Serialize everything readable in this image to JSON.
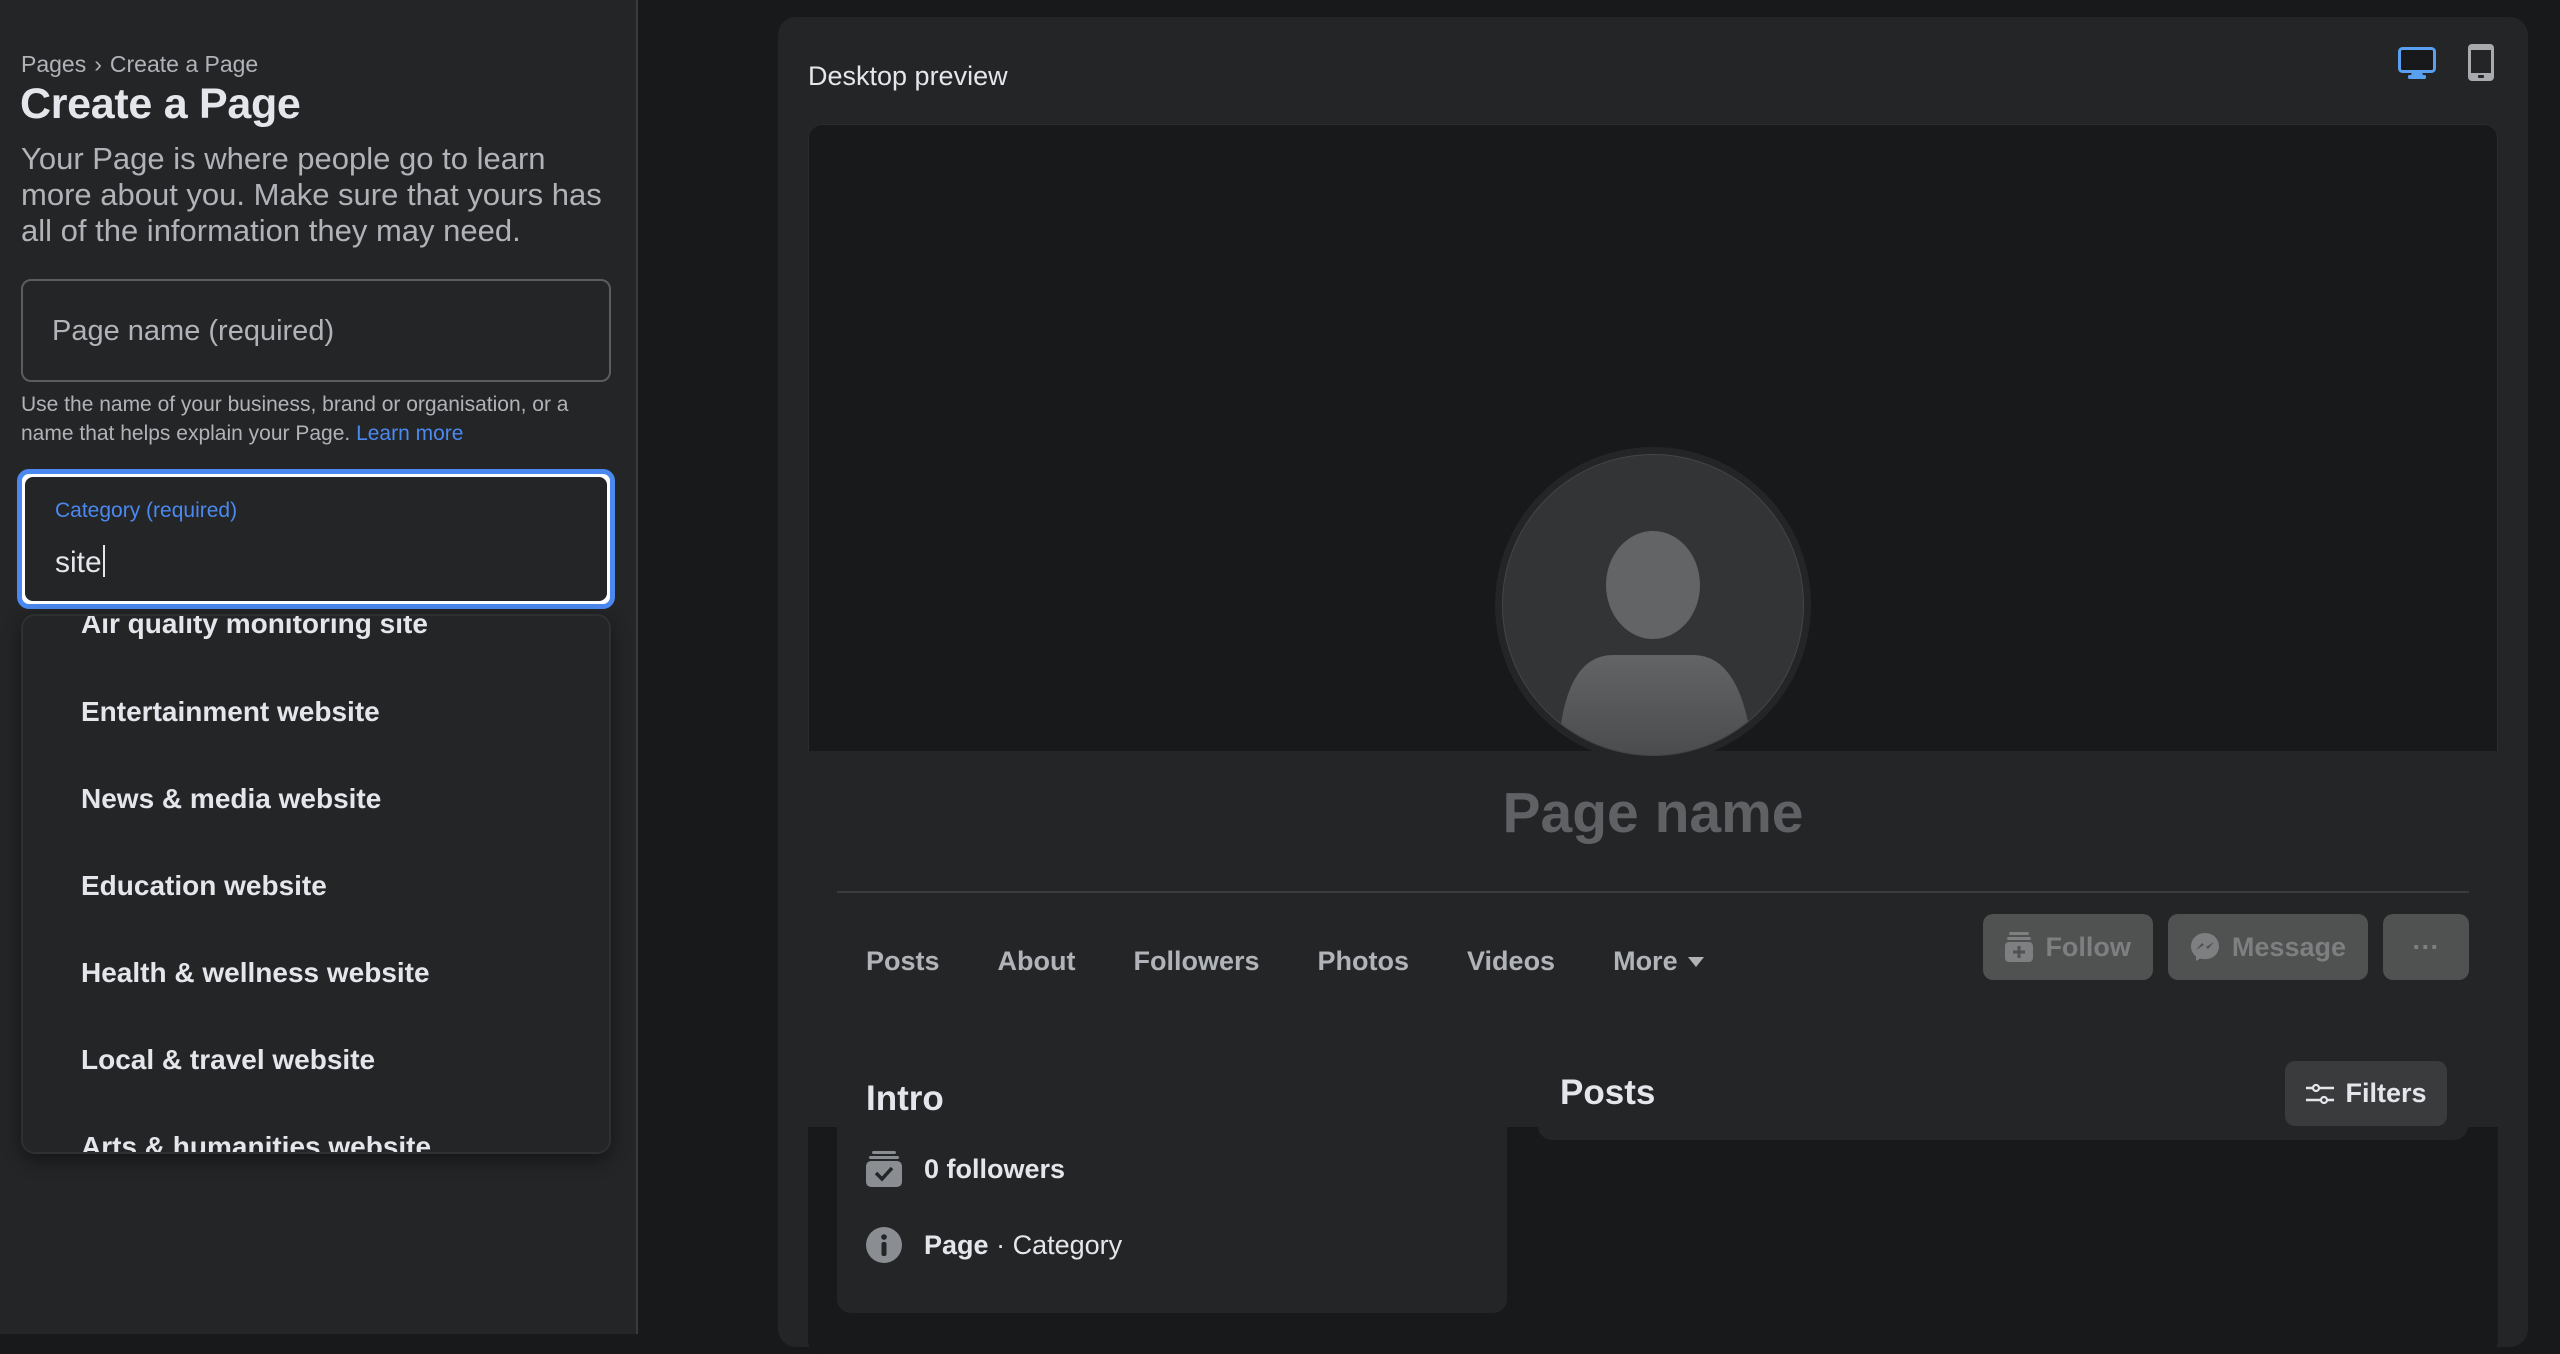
{
  "sidebar": {
    "breadcrumb": {
      "root": "Pages",
      "separator": "›",
      "current": "Create a Page"
    },
    "title": "Create a Page",
    "description": "Your Page is where people go to learn more about you. Make sure that yours has all of the information they may need.",
    "page_name_field": {
      "placeholder": "Page name (required)",
      "value": ""
    },
    "helper_text": "Use the name of your business, brand or organisation, or a name that helps explain your Page.",
    "helper_link": "Learn more",
    "category_field": {
      "label": "Category (required)",
      "value": "site"
    },
    "category_suggestions": [
      "Air quality monitoring site",
      "Entertainment website",
      "News & media website",
      "Education website",
      "Health & wellness website",
      "Local & travel website",
      "Arts & humanities website"
    ]
  },
  "preview": {
    "title": "Desktop preview",
    "devices": [
      {
        "name": "desktop",
        "icon": "desktop-icon",
        "active": true
      },
      {
        "name": "mobile",
        "icon": "mobile-icon",
        "active": false
      }
    ],
    "page_name": "Page name",
    "tabs": [
      "Posts",
      "About",
      "Followers",
      "Photos",
      "Videos",
      "More"
    ],
    "actions": {
      "follow": "Follow",
      "message": "Message",
      "more": "···"
    },
    "intro": {
      "title": "Intro",
      "followers": "0 followers",
      "page_label": "Page",
      "separator": "·",
      "category": "Category"
    },
    "posts": {
      "title": "Posts",
      "filters": "Filters"
    }
  },
  "colors": {
    "accent": "#4b89f0",
    "sidebar_bg": "#242526",
    "main_bg": "#18191a",
    "text": "#e4e6eb",
    "muted": "#b0b3b8"
  }
}
